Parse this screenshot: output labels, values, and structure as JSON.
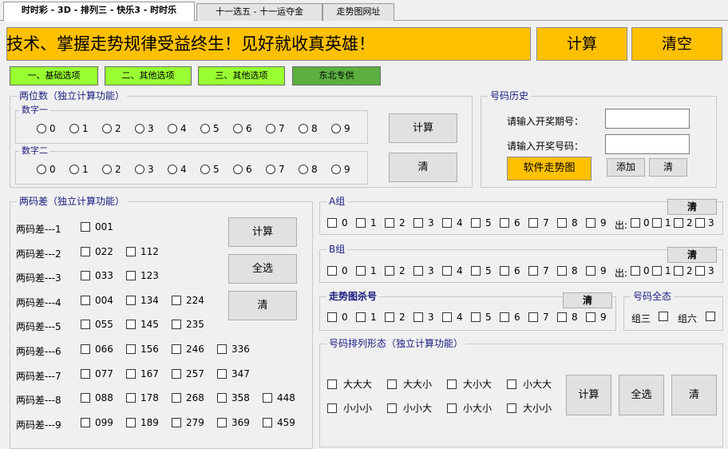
{
  "tabs": [
    {
      "label": "时时彩 - 3D - 排列三 - 快乐3 - 时时乐"
    },
    {
      "label": "十一选五 - 十一运夺金"
    },
    {
      "label": "走势图网址"
    }
  ],
  "banner": {
    "text": "势技术、掌握走势规律受益终生！见好就收真英雄！"
  },
  "top_buttons": {
    "calc": "计算",
    "clear": "清空"
  },
  "option_buttons": [
    "一、基础选项",
    "二、其他选项",
    "三、其他选项",
    "东北专供"
  ],
  "two_digit": {
    "title": "两位数（独立计算功能）",
    "digit1_title": "数字一",
    "digit2_title": "数字二",
    "digits": [
      "0",
      "1",
      "2",
      "3",
      "4",
      "5",
      "6",
      "7",
      "8",
      "9"
    ],
    "calc": "计算",
    "clear": "清"
  },
  "history": {
    "title": "号码历史",
    "period_label": "请输入开奖期号：",
    "number_label": "请输入开奖号码：",
    "period_value": "",
    "number_value": "",
    "software_btn": "软件走势图",
    "add_btn": "添加",
    "clear_btn": "清"
  },
  "diff": {
    "title": "两码差（独立计算功能）",
    "rows": [
      {
        "label": "两码差---1",
        "items": [
          "001"
        ]
      },
      {
        "label": "两码差---2",
        "items": [
          "022",
          "112"
        ]
      },
      {
        "label": "两码差---3",
        "items": [
          "033",
          "123"
        ]
      },
      {
        "label": "两码差---4",
        "items": [
          "004",
          "134",
          "224"
        ]
      },
      {
        "label": "两码差---5",
        "items": [
          "055",
          "145",
          "235"
        ]
      },
      {
        "label": "两码差---6",
        "items": [
          "066",
          "156",
          "246",
          "336"
        ]
      },
      {
        "label": "两码差---7",
        "items": [
          "077",
          "167",
          "257",
          "347"
        ]
      },
      {
        "label": "两码差---8",
        "items": [
          "088",
          "178",
          "268",
          "358",
          "448"
        ]
      },
      {
        "label": "两码差---9",
        "items": [
          "099",
          "189",
          "279",
          "369",
          "459"
        ]
      }
    ],
    "calc": "计算",
    "select_all": "全选",
    "clear": "清"
  },
  "group_a": {
    "title": "A组",
    "clear": "清",
    "digits": [
      "0",
      "1",
      "2",
      "3",
      "4",
      "5",
      "6",
      "7",
      "8",
      "9"
    ],
    "out_label": "出:",
    "out_digits": [
      "0",
      "1",
      "2",
      "3"
    ]
  },
  "group_b": {
    "title": "B组",
    "clear": "清",
    "digits": [
      "0",
      "1",
      "2",
      "3",
      "4",
      "5",
      "6",
      "7",
      "8",
      "9"
    ],
    "out_label": "出:",
    "out_digits": [
      "0",
      "1",
      "2",
      "3"
    ]
  },
  "trend_kill": {
    "title": "走势图杀号",
    "clear": "清",
    "digits": [
      "0",
      "1",
      "2",
      "3",
      "4",
      "5",
      "6",
      "7",
      "8",
      "9"
    ]
  },
  "full_state": {
    "title": "号码全态",
    "options": [
      "组三",
      "组六"
    ]
  },
  "pattern": {
    "title": "号码排列形态（独立计算功能）",
    "row1": [
      "大大大",
      "大大小",
      "大小大",
      "小大大"
    ],
    "row2": [
      "小小小",
      "小小大",
      "小大小",
      "大小小"
    ],
    "calc": "计算",
    "select_all": "全选",
    "clear": "清"
  }
}
